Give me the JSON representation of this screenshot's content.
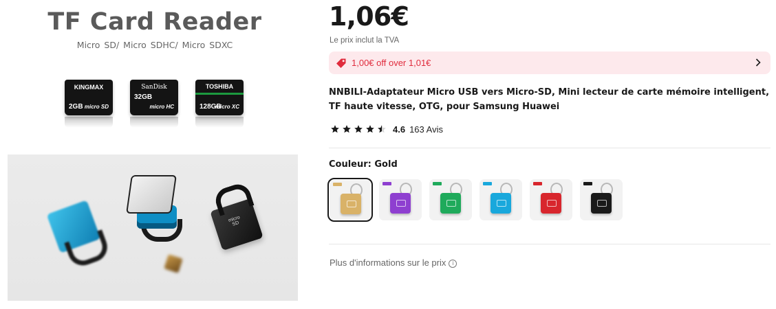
{
  "product_image": {
    "headline": "TF Card Reader",
    "subheadline": "Micro SD/ Micro SDHC/  Micro SDXC",
    "cards": [
      {
        "brand": "KINGMAX",
        "capacity": "2GB",
        "logo": "micro SD",
        "color": "#141414"
      },
      {
        "brand": "SanDisk",
        "capacity": "32GB",
        "logo": "micro HC",
        "color": "#141414"
      },
      {
        "brand": "TOSHIBA",
        "capacity": "128GB",
        "logo": "micro XC",
        "color": "#141414"
      }
    ]
  },
  "price": {
    "amount": "1,06€",
    "tax_note": "Le prix inclut la TVA"
  },
  "promo": {
    "text": "1,00€ off over 1,01€",
    "color": "#e02b3c",
    "background": "#fde9ec",
    "icon": "price-tag-icon"
  },
  "product": {
    "title": "NNBILI-Adaptateur Micro USB vers Micro-SD, Mini lecteur de carte mémoire intelligent, TF haute vitesse, OTG, pour Samsung Huawei"
  },
  "rating": {
    "score": "4.6",
    "stars": 4.5,
    "reviews": "163 Avis"
  },
  "color_selector": {
    "label": "Couleur: Gold",
    "selected_index": 0,
    "options": [
      {
        "name": "Gold",
        "color": "#d9b268"
      },
      {
        "name": "Purple",
        "color": "#8e3fd0"
      },
      {
        "name": "Green",
        "color": "#1faa5b"
      },
      {
        "name": "Blue",
        "color": "#19a8dc"
      },
      {
        "name": "Red",
        "color": "#d8262d"
      },
      {
        "name": "Black",
        "color": "#1a1a1a"
      }
    ]
  },
  "more_info": {
    "text": "Plus d'informations sur le prix",
    "icon": "info-icon"
  }
}
